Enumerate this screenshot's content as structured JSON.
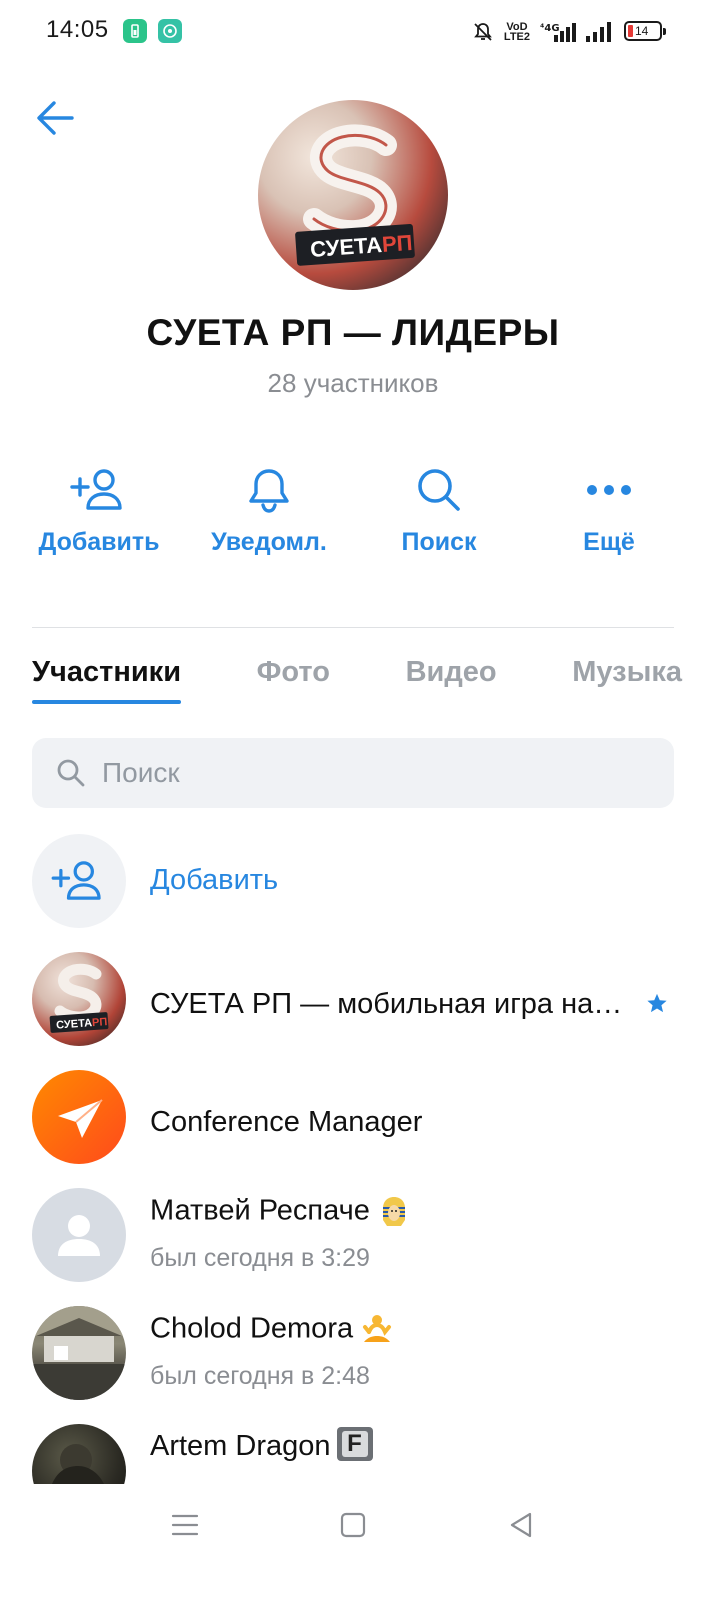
{
  "status_bar": {
    "time": "14:05",
    "net_top": "VoD",
    "net_bottom": "LTE2",
    "net_type": "4G",
    "battery": "14",
    "battery_color": "#e53935"
  },
  "header": {
    "title": "СУЕТА РП — ЛИДЕРЫ",
    "subtitle": "28 участников",
    "avatar_text": "СУЕТАРП"
  },
  "actions": [
    {
      "label": "Добавить",
      "icon": "add-user-icon"
    },
    {
      "label": "Уведомл.",
      "icon": "bell-icon"
    },
    {
      "label": "Поиск",
      "icon": "search-icon"
    },
    {
      "label": "Ещё",
      "icon": "more-icon"
    }
  ],
  "tabs": [
    {
      "label": "Участники",
      "active": true
    },
    {
      "label": "Фото",
      "active": false
    },
    {
      "label": "Видео",
      "active": false
    },
    {
      "label": "Музыка",
      "active": false
    }
  ],
  "search": {
    "placeholder": "Поиск"
  },
  "members": {
    "add_label": "Добавить",
    "items": [
      {
        "name": "СУЕТА РП — мобильная игра на…",
        "status": "",
        "badge": "star-icon",
        "avatar_text": "СУЕТАРП"
      },
      {
        "name": "Conference Manager",
        "status": "",
        "avatar": "paper-plane-icon"
      },
      {
        "name": "Матвей Респаче",
        "status": "был сегодня в 3:29",
        "emoji": "pharaoh"
      },
      {
        "name": "Cholod Demora",
        "status": "был сегодня в 2:48",
        "emoji": "person-in-lotus-position"
      },
      {
        "name": "Artem Dragon",
        "status": "",
        "emoji_letter": "F"
      }
    ]
  },
  "colors": {
    "accent": "#2787e0",
    "secondary_text": "#8a8d92",
    "search_bg": "#f0f2f5"
  }
}
